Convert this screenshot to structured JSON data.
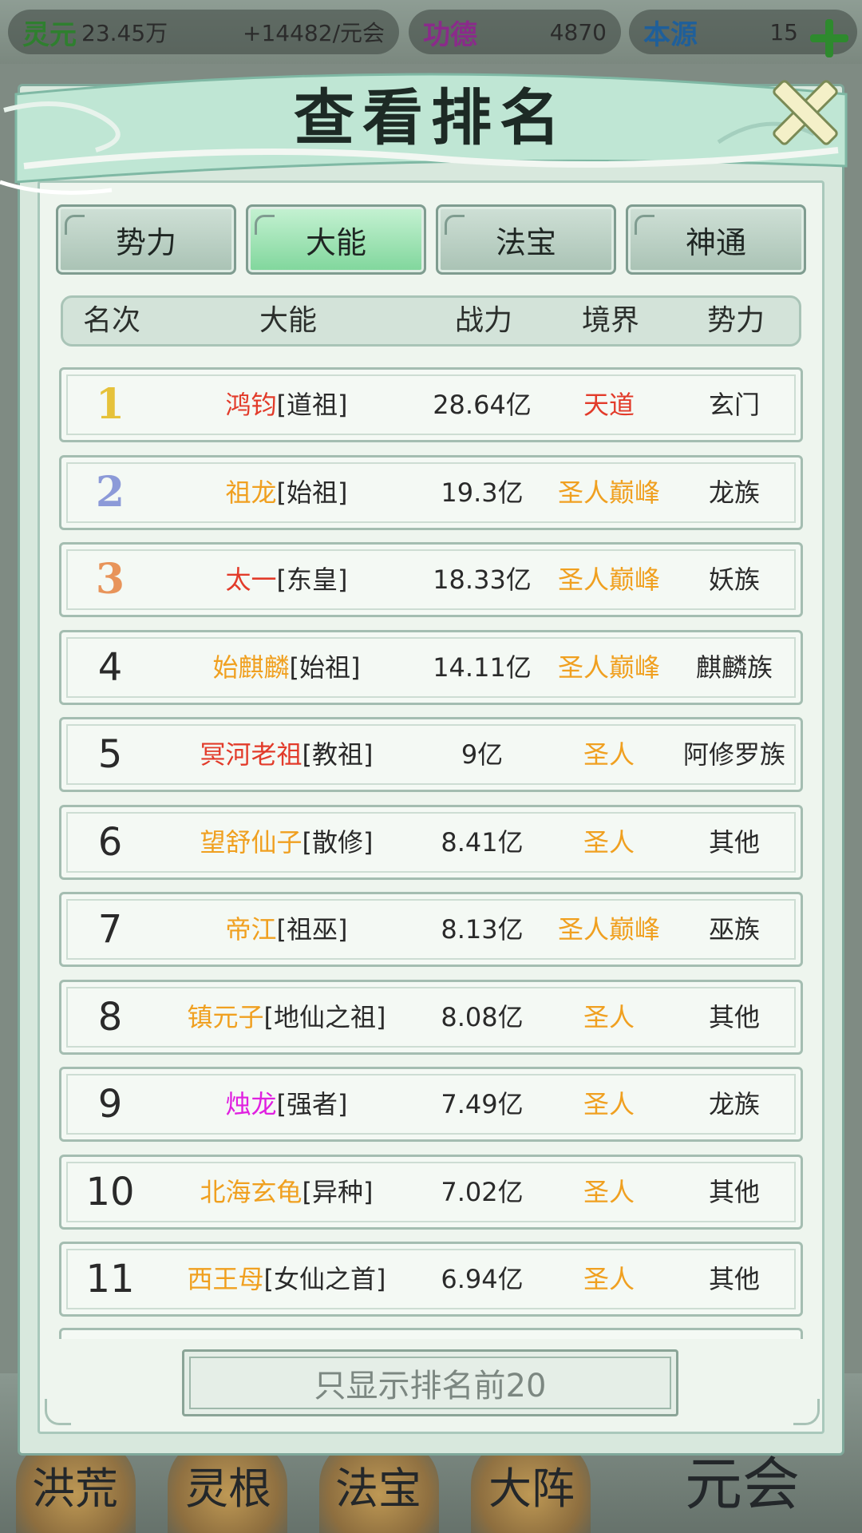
{
  "resources": [
    {
      "label": "灵元",
      "value": "23.45万",
      "rate": "+14482/元会",
      "color": "#2f7f2f"
    },
    {
      "label": "功德",
      "value": "4870",
      "color": "#8a2b8a"
    },
    {
      "label": "本源",
      "value": "15",
      "color": "#1f5f9a"
    }
  ],
  "modal": {
    "title": "查看排名",
    "tabs": [
      {
        "label": "势力",
        "active": false
      },
      {
        "label": "大能",
        "active": true
      },
      {
        "label": "法宝",
        "active": false
      },
      {
        "label": "神通",
        "active": false
      }
    ],
    "columns": [
      "名次",
      "大能",
      "战力",
      "境界",
      "势力"
    ],
    "rows": [
      {
        "rank": "1",
        "name": "鸿钧",
        "title": "[道祖]",
        "name_color": "#e23b2a",
        "power": "28.64亿",
        "realm": "天道",
        "realm_color": "#e23b2a",
        "faction": "玄门"
      },
      {
        "rank": "2",
        "name": "祖龙",
        "title": "[始祖]",
        "name_color": "#f0a020",
        "power": "19.3亿",
        "realm": "圣人巅峰",
        "realm_color": "#f0a020",
        "faction": "龙族"
      },
      {
        "rank": "3",
        "name": "太一",
        "title": "[东皇]",
        "name_color": "#e23b2a",
        "power": "18.33亿",
        "realm": "圣人巅峰",
        "realm_color": "#f0a020",
        "faction": "妖族"
      },
      {
        "rank": "4",
        "name": "始麒麟",
        "title": "[始祖]",
        "name_color": "#f0a020",
        "power": "14.11亿",
        "realm": "圣人巅峰",
        "realm_color": "#f0a020",
        "faction": "麒麟族"
      },
      {
        "rank": "5",
        "name": "冥河老祖",
        "title": "[教祖]",
        "name_color": "#e23b2a",
        "power": "9亿",
        "realm": "圣人",
        "realm_color": "#f0a020",
        "faction": "阿修罗族"
      },
      {
        "rank": "6",
        "name": "望舒仙子",
        "title": "[散修]",
        "name_color": "#f0a020",
        "power": "8.41亿",
        "realm": "圣人",
        "realm_color": "#f0a020",
        "faction": "其他"
      },
      {
        "rank": "7",
        "name": "帝江",
        "title": "[祖巫]",
        "name_color": "#f0a020",
        "power": "8.13亿",
        "realm": "圣人巅峰",
        "realm_color": "#f0a020",
        "faction": "巫族"
      },
      {
        "rank": "8",
        "name": "镇元子",
        "title": "[地仙之祖]",
        "name_color": "#f0a020",
        "power": "8.08亿",
        "realm": "圣人",
        "realm_color": "#f0a020",
        "faction": "其他"
      },
      {
        "rank": "9",
        "name": "烛龙",
        "title": "[强者]",
        "name_color": "#e020e0",
        "power": "7.49亿",
        "realm": "圣人",
        "realm_color": "#f0a020",
        "faction": "龙族"
      },
      {
        "rank": "10",
        "name": "北海玄龟",
        "title": "[异种]",
        "name_color": "#f0a020",
        "power": "7.02亿",
        "realm": "圣人",
        "realm_color": "#f0a020",
        "faction": "其他"
      },
      {
        "rank": "11",
        "name": "西王母",
        "title": "[女仙之首]",
        "name_color": "#f0a020",
        "power": "6.94亿",
        "realm": "圣人",
        "realm_color": "#f0a020",
        "faction": "其他"
      }
    ],
    "top_rank_colors": [
      "#e6c23a",
      "#8c9ad8",
      "#e8945a"
    ],
    "footer_button": "只显示排名前20",
    "close_icon": "close-icon"
  },
  "bottom_nav": [
    "洪荒",
    "灵根",
    "法宝",
    "大阵",
    "元会"
  ]
}
